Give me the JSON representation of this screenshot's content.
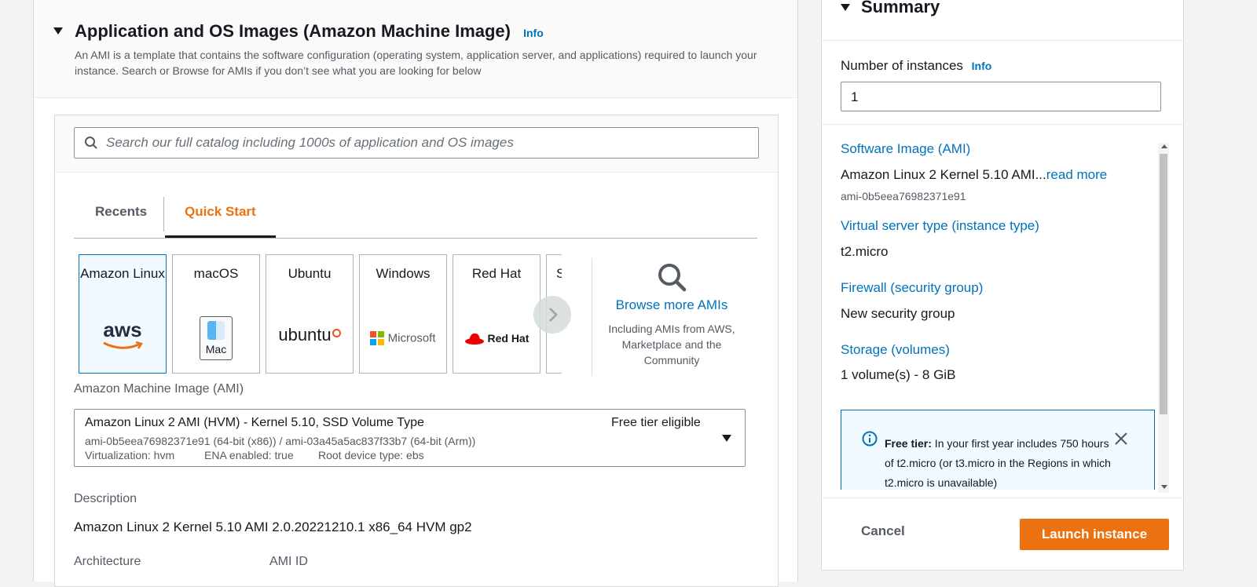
{
  "ami_section": {
    "title": "Application and OS Images (Amazon Machine Image)",
    "info": "Info",
    "description": "An AMI is a template that contains the software configuration (operating system, application server, and applications) required to launch your instance. Search or Browse for AMIs if you don’t see what you are looking for below",
    "search": {
      "placeholder": "Search our full catalog including 1000s of application and OS images"
    },
    "tabs": [
      {
        "label": "Recents"
      },
      {
        "label": "Quick Start"
      }
    ],
    "active_tab": "Quick Start",
    "os_cards": [
      {
        "name": "Amazon Linux",
        "logo_text": "aws",
        "selected": true
      },
      {
        "name": "macOS",
        "logo_text": "Mac"
      },
      {
        "name": "Ubuntu",
        "logo_text": "ubuntu"
      },
      {
        "name": "Windows",
        "logo_text": "Microsoft"
      },
      {
        "name": "Red Hat",
        "logo_text": "Red Hat"
      },
      {
        "name": "S"
      }
    ],
    "browse": {
      "label": "Browse more AMIs",
      "sub": "Including AMIs from AWS, Marketplace and the Community"
    },
    "ami_label": "Amazon Machine Image (AMI)",
    "ami_select": {
      "name": "Amazon Linux 2 AMI (HVM) - Kernel 5.10, SSD Volume Type",
      "badge": "Free tier eligible",
      "ids": "ami-0b5eea76982371e91 (64-bit (x86)) / ami-03a45a5ac837f33b7 (64-bit (Arm))",
      "virtualization": "Virtualization: hvm",
      "ena": "ENA enabled: true",
      "root": "Root device type: ebs"
    },
    "description_label": "Description",
    "description_value": "Amazon Linux 2 Kernel 5.10 AMI 2.0.20221210.1 x86_64 HVM gp2",
    "architecture_label": "Architecture",
    "ami_id_label": "AMI ID"
  },
  "summary": {
    "title": "Summary",
    "instances_label": "Number of instances",
    "instances_info": "Info",
    "instances_value": "1",
    "software_image_label": "Software Image (AMI)",
    "software_image_value": "Amazon Linux 2 Kernel 5.10 AMI...",
    "read_more": "read more",
    "software_image_id": "ami-0b5eea76982371e91",
    "instance_type_label": "Virtual server type (instance type)",
    "instance_type_value": "t2.micro",
    "firewall_label": "Firewall (security group)",
    "firewall_value": "New security group",
    "storage_label": "Storage (volumes)",
    "storage_value": "1 volume(s) - 8 GiB",
    "free_tier_title": "Free tier:",
    "free_tier_text": " In your first year includes 750 hours of t2.micro (or t3.micro in the Regions in which t2.micro is unavailable)",
    "cancel": "Cancel",
    "launch": "Launch instance"
  },
  "colors": {
    "accent_orange": "#ec7211",
    "link_blue": "#0073bb",
    "tab_active": "#ec7211"
  }
}
